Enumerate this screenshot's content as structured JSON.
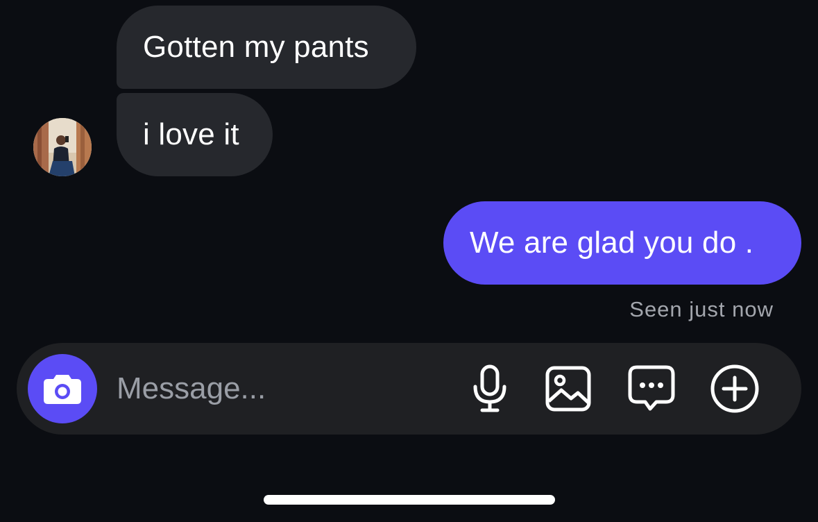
{
  "messages": [
    {
      "text": "Gotten my pants",
      "direction": "incoming"
    },
    {
      "text": "i love it",
      "direction": "incoming"
    },
    {
      "text": "We are glad you do .",
      "direction": "outgoing"
    }
  ],
  "status": {
    "seen": "Seen just now"
  },
  "composer": {
    "placeholder": "Message..."
  },
  "icons": {
    "camera": "camera-icon",
    "mic": "microphone-icon",
    "gallery": "gallery-icon",
    "sticker": "chat-bubble-icon",
    "plus": "plus-circle-icon"
  },
  "colors": {
    "background": "#0b0d12",
    "incoming_bubble": "#26282d",
    "outgoing_bubble": "#5b4cf5",
    "composer": "#1f2023",
    "accent": "#5b4cf5",
    "status_text": "#a3a6ad"
  }
}
